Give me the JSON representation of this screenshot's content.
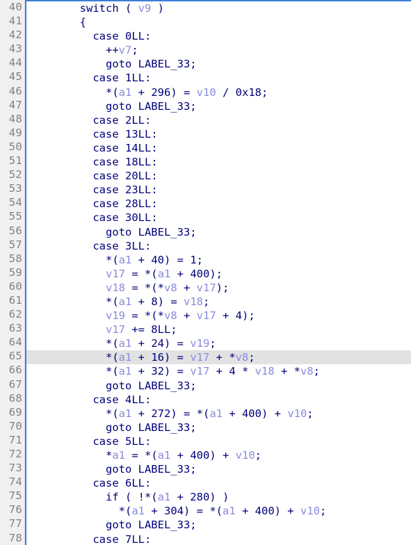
{
  "editor": {
    "kind": "decompiler-pseudocode-view",
    "first_line_number": 40,
    "last_line_number": 78,
    "highlighted_line": 65,
    "colors": {
      "background": "#ffffff",
      "gutter_background": "#f0f0f0",
      "gutter_text": "#808080",
      "gutter_border": "#dcdcdc",
      "pane_border": "#3a7fd5",
      "code_default": "#00007b",
      "variable": "#8a8ae0",
      "highlight_row": "#e2e2e2"
    }
  },
  "lines": [
    {
      "num": "40",
      "indent": 8,
      "tokens": [
        {
          "t": "switch ( ",
          "c": "plain"
        },
        {
          "t": "v9",
          "c": "var"
        },
        {
          "t": " )",
          "c": "plain"
        }
      ]
    },
    {
      "num": "41",
      "indent": 8,
      "tokens": [
        {
          "t": "{",
          "c": "plain"
        }
      ]
    },
    {
      "num": "42",
      "indent": 10,
      "tokens": [
        {
          "t": "case 0LL:",
          "c": "plain"
        }
      ]
    },
    {
      "num": "43",
      "indent": 12,
      "tokens": [
        {
          "t": "++",
          "c": "plain"
        },
        {
          "t": "v7",
          "c": "var"
        },
        {
          "t": ";",
          "c": "plain"
        }
      ]
    },
    {
      "num": "44",
      "indent": 12,
      "tokens": [
        {
          "t": "goto LABEL_33;",
          "c": "plain"
        }
      ]
    },
    {
      "num": "45",
      "indent": 10,
      "tokens": [
        {
          "t": "case 1LL:",
          "c": "plain"
        }
      ]
    },
    {
      "num": "46",
      "indent": 12,
      "tokens": [
        {
          "t": "*(",
          "c": "plain"
        },
        {
          "t": "a1",
          "c": "var"
        },
        {
          "t": " + 296) = ",
          "c": "plain"
        },
        {
          "t": "v10",
          "c": "var"
        },
        {
          "t": " / 0x18;",
          "c": "plain"
        }
      ]
    },
    {
      "num": "47",
      "indent": 12,
      "tokens": [
        {
          "t": "goto LABEL_33;",
          "c": "plain"
        }
      ]
    },
    {
      "num": "48",
      "indent": 10,
      "tokens": [
        {
          "t": "case 2LL:",
          "c": "plain"
        }
      ]
    },
    {
      "num": "49",
      "indent": 10,
      "tokens": [
        {
          "t": "case 13LL:",
          "c": "plain"
        }
      ]
    },
    {
      "num": "50",
      "indent": 10,
      "tokens": [
        {
          "t": "case 14LL:",
          "c": "plain"
        }
      ]
    },
    {
      "num": "51",
      "indent": 10,
      "tokens": [
        {
          "t": "case 18LL:",
          "c": "plain"
        }
      ]
    },
    {
      "num": "52",
      "indent": 10,
      "tokens": [
        {
          "t": "case 20LL:",
          "c": "plain"
        }
      ]
    },
    {
      "num": "53",
      "indent": 10,
      "tokens": [
        {
          "t": "case 23LL:",
          "c": "plain"
        }
      ]
    },
    {
      "num": "54",
      "indent": 10,
      "tokens": [
        {
          "t": "case 28LL:",
          "c": "plain"
        }
      ]
    },
    {
      "num": "55",
      "indent": 10,
      "tokens": [
        {
          "t": "case 30LL:",
          "c": "plain"
        }
      ]
    },
    {
      "num": "56",
      "indent": 12,
      "tokens": [
        {
          "t": "goto LABEL_33;",
          "c": "plain"
        }
      ]
    },
    {
      "num": "57",
      "indent": 10,
      "tokens": [
        {
          "t": "case 3LL:",
          "c": "plain"
        }
      ]
    },
    {
      "num": "58",
      "indent": 12,
      "tokens": [
        {
          "t": "*(",
          "c": "plain"
        },
        {
          "t": "a1",
          "c": "var"
        },
        {
          "t": " + 40) = 1;",
          "c": "plain"
        }
      ]
    },
    {
      "num": "59",
      "indent": 12,
      "tokens": [
        {
          "t": "v17",
          "c": "var"
        },
        {
          "t": " = *(",
          "c": "plain"
        },
        {
          "t": "a1",
          "c": "var"
        },
        {
          "t": " + 400);",
          "c": "plain"
        }
      ]
    },
    {
      "num": "60",
      "indent": 12,
      "tokens": [
        {
          "t": "v18",
          "c": "var"
        },
        {
          "t": " = *(*",
          "c": "plain"
        },
        {
          "t": "v8",
          "c": "var"
        },
        {
          "t": " + ",
          "c": "plain"
        },
        {
          "t": "v17",
          "c": "var"
        },
        {
          "t": ");",
          "c": "plain"
        }
      ]
    },
    {
      "num": "61",
      "indent": 12,
      "tokens": [
        {
          "t": "*(",
          "c": "plain"
        },
        {
          "t": "a1",
          "c": "var"
        },
        {
          "t": " + 8) = ",
          "c": "plain"
        },
        {
          "t": "v18",
          "c": "var"
        },
        {
          "t": ";",
          "c": "plain"
        }
      ]
    },
    {
      "num": "62",
      "indent": 12,
      "tokens": [
        {
          "t": "v19",
          "c": "var"
        },
        {
          "t": " = *(*",
          "c": "plain"
        },
        {
          "t": "v8",
          "c": "var"
        },
        {
          "t": " + ",
          "c": "plain"
        },
        {
          "t": "v17",
          "c": "var"
        },
        {
          "t": " + 4);",
          "c": "plain"
        }
      ]
    },
    {
      "num": "63",
      "indent": 12,
      "tokens": [
        {
          "t": "v17",
          "c": "var"
        },
        {
          "t": " += 8LL;",
          "c": "plain"
        }
      ]
    },
    {
      "num": "64",
      "indent": 12,
      "tokens": [
        {
          "t": "*(",
          "c": "plain"
        },
        {
          "t": "a1",
          "c": "var"
        },
        {
          "t": " + 24) = ",
          "c": "plain"
        },
        {
          "t": "v19",
          "c": "var"
        },
        {
          "t": ";",
          "c": "plain"
        }
      ]
    },
    {
      "num": "65",
      "indent": 12,
      "tokens": [
        {
          "t": "*(",
          "c": "plain"
        },
        {
          "t": "a1",
          "c": "var"
        },
        {
          "t": " + 16) = ",
          "c": "plain"
        },
        {
          "t": "v17",
          "c": "var"
        },
        {
          "t": " + *",
          "c": "plain"
        },
        {
          "t": "v8",
          "c": "var"
        },
        {
          "t": ";",
          "c": "plain"
        }
      ]
    },
    {
      "num": "66",
      "indent": 12,
      "tokens": [
        {
          "t": "*(",
          "c": "plain"
        },
        {
          "t": "a1",
          "c": "var"
        },
        {
          "t": " + 32) = ",
          "c": "plain"
        },
        {
          "t": "v17",
          "c": "var"
        },
        {
          "t": " + 4 * ",
          "c": "plain"
        },
        {
          "t": "v18",
          "c": "var"
        },
        {
          "t": " + *",
          "c": "plain"
        },
        {
          "t": "v8",
          "c": "var"
        },
        {
          "t": ";",
          "c": "plain"
        }
      ]
    },
    {
      "num": "67",
      "indent": 12,
      "tokens": [
        {
          "t": "goto LABEL_33;",
          "c": "plain"
        }
      ]
    },
    {
      "num": "68",
      "indent": 10,
      "tokens": [
        {
          "t": "case 4LL:",
          "c": "plain"
        }
      ]
    },
    {
      "num": "69",
      "indent": 12,
      "tokens": [
        {
          "t": "*(",
          "c": "plain"
        },
        {
          "t": "a1",
          "c": "var"
        },
        {
          "t": " + 272) = *(",
          "c": "plain"
        },
        {
          "t": "a1",
          "c": "var"
        },
        {
          "t": " + 400) + ",
          "c": "plain"
        },
        {
          "t": "v10",
          "c": "var"
        },
        {
          "t": ";",
          "c": "plain"
        }
      ]
    },
    {
      "num": "70",
      "indent": 12,
      "tokens": [
        {
          "t": "goto LABEL_33;",
          "c": "plain"
        }
      ]
    },
    {
      "num": "71",
      "indent": 10,
      "tokens": [
        {
          "t": "case 5LL:",
          "c": "plain"
        }
      ]
    },
    {
      "num": "72",
      "indent": 12,
      "tokens": [
        {
          "t": "*",
          "c": "plain"
        },
        {
          "t": "a1",
          "c": "var"
        },
        {
          "t": " = *(",
          "c": "plain"
        },
        {
          "t": "a1",
          "c": "var"
        },
        {
          "t": " + 400) + ",
          "c": "plain"
        },
        {
          "t": "v10",
          "c": "var"
        },
        {
          "t": ";",
          "c": "plain"
        }
      ]
    },
    {
      "num": "73",
      "indent": 12,
      "tokens": [
        {
          "t": "goto LABEL_33;",
          "c": "plain"
        }
      ]
    },
    {
      "num": "74",
      "indent": 10,
      "tokens": [
        {
          "t": "case 6LL:",
          "c": "plain"
        }
      ]
    },
    {
      "num": "75",
      "indent": 12,
      "tokens": [
        {
          "t": "if ( !*(",
          "c": "plain"
        },
        {
          "t": "a1",
          "c": "var"
        },
        {
          "t": " + 280) )",
          "c": "plain"
        }
      ]
    },
    {
      "num": "76",
      "indent": 14,
      "tokens": [
        {
          "t": "*(",
          "c": "plain"
        },
        {
          "t": "a1",
          "c": "var"
        },
        {
          "t": " + 304) = *(",
          "c": "plain"
        },
        {
          "t": "a1",
          "c": "var"
        },
        {
          "t": " + 400) + ",
          "c": "plain"
        },
        {
          "t": "v10",
          "c": "var"
        },
        {
          "t": ";",
          "c": "plain"
        }
      ]
    },
    {
      "num": "77",
      "indent": 12,
      "tokens": [
        {
          "t": "goto LABEL_33;",
          "c": "plain"
        }
      ]
    },
    {
      "num": "78",
      "indent": 10,
      "tokens": [
        {
          "t": "case 7LL:",
          "c": "plain"
        }
      ]
    }
  ]
}
